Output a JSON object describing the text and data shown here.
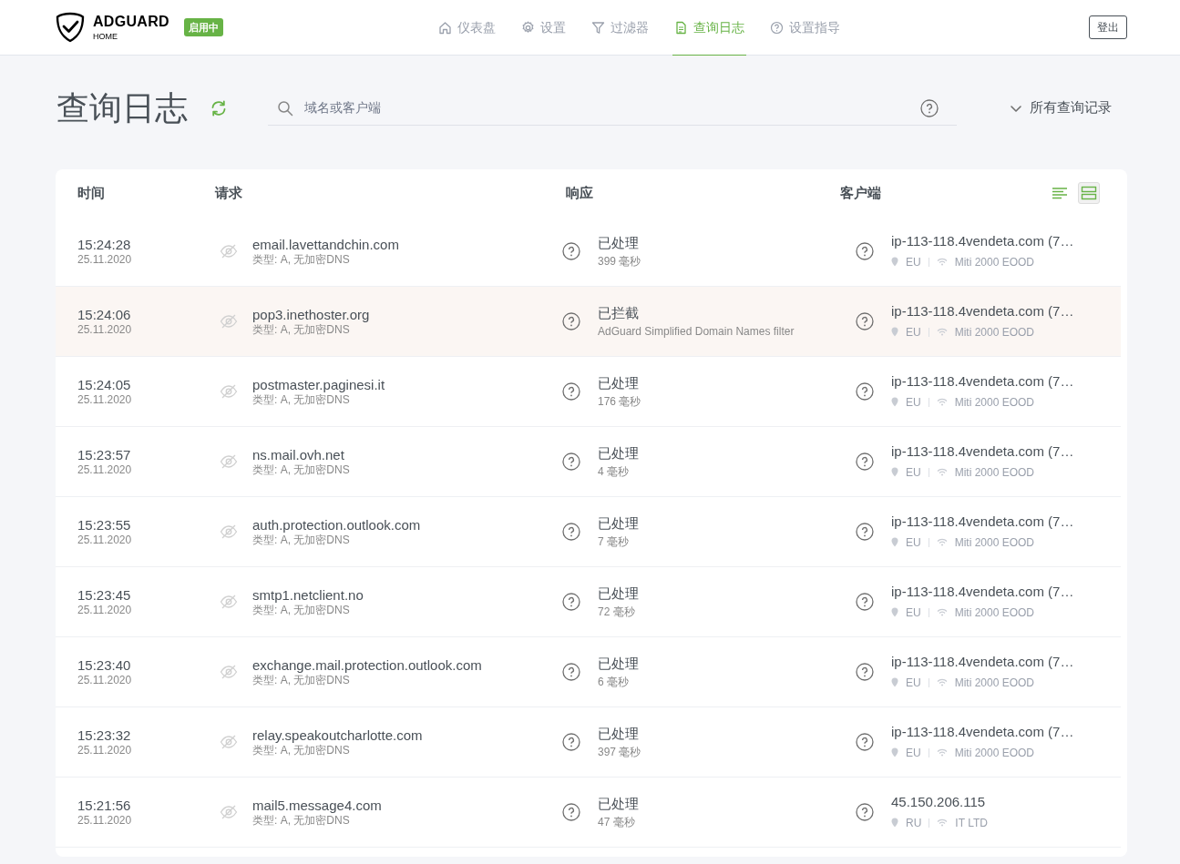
{
  "header": {
    "logo_title": "ADGUARD",
    "logo_subtitle": "HOME",
    "status_badge": "启用中",
    "nav": [
      {
        "label": "仪表盘",
        "selected": false
      },
      {
        "label": "设置",
        "selected": false
      },
      {
        "label": "过滤器",
        "selected": false
      },
      {
        "label": "查询日志",
        "selected": true
      },
      {
        "label": "设置指导",
        "selected": false
      }
    ],
    "logout_button": "登出"
  },
  "page_title": "查询日志",
  "search": {
    "placeholder": "域名或客户端"
  },
  "filter_dropdown": "所有查询记录",
  "table": {
    "columns": [
      "时间",
      "请求",
      "响应",
      "客户端"
    ],
    "view_toggle": [
      {
        "kind": "compact",
        "selected": false
      },
      {
        "kind": "default",
        "selected": true
      }
    ],
    "rows": [
      {
        "time": "15:24:28",
        "date": "25.11.2020",
        "domain": "email.lavettandchin.com",
        "type": "类型: A, 无加密DNS",
        "status": "已处理",
        "detail": "399 毫秒",
        "blocked": false,
        "client": "ip-113-118.4vendeta.com (7…",
        "country": "EU",
        "network": "Miti 2000 EOOD"
      },
      {
        "time": "15:24:06",
        "date": "25.11.2020",
        "domain": "pop3.inethoster.org",
        "type": "类型: A, 无加密DNS",
        "status": "已拦截",
        "detail": "AdGuard Simplified Domain Names filter",
        "blocked": true,
        "client": "ip-113-118.4vendeta.com (7…",
        "country": "EU",
        "network": "Miti 2000 EOOD"
      },
      {
        "time": "15:24:05",
        "date": "25.11.2020",
        "domain": "postmaster.paginesi.it",
        "type": "类型: A, 无加密DNS",
        "status": "已处理",
        "detail": "176 毫秒",
        "blocked": false,
        "client": "ip-113-118.4vendeta.com (7…",
        "country": "EU",
        "network": "Miti 2000 EOOD"
      },
      {
        "time": "15:23:57",
        "date": "25.11.2020",
        "domain": "ns.mail.ovh.net",
        "type": "类型: A, 无加密DNS",
        "status": "已处理",
        "detail": "4 毫秒",
        "blocked": false,
        "client": "ip-113-118.4vendeta.com (7…",
        "country": "EU",
        "network": "Miti 2000 EOOD"
      },
      {
        "time": "15:23:55",
        "date": "25.11.2020",
        "domain": "auth.protection.outlook.com",
        "type": "类型: A, 无加密DNS",
        "status": "已处理",
        "detail": "7 毫秒",
        "blocked": false,
        "client": "ip-113-118.4vendeta.com (7…",
        "country": "EU",
        "network": "Miti 2000 EOOD"
      },
      {
        "time": "15:23:45",
        "date": "25.11.2020",
        "domain": "smtp1.netclient.no",
        "type": "类型: A, 无加密DNS",
        "status": "已处理",
        "detail": "72 毫秒",
        "blocked": false,
        "client": "ip-113-118.4vendeta.com (7…",
        "country": "EU",
        "network": "Miti 2000 EOOD"
      },
      {
        "time": "15:23:40",
        "date": "25.11.2020",
        "domain": "exchange.mail.protection.outlook.com",
        "type": "类型: A, 无加密DNS",
        "status": "已处理",
        "detail": "6 毫秒",
        "blocked": false,
        "client": "ip-113-118.4vendeta.com (7…",
        "country": "EU",
        "network": "Miti 2000 EOOD"
      },
      {
        "time": "15:23:32",
        "date": "25.11.2020",
        "domain": "relay.speakoutcharlotte.com",
        "type": "类型: A, 无加密DNS",
        "status": "已处理",
        "detail": "397 毫秒",
        "blocked": false,
        "client": "ip-113-118.4vendeta.com (7…",
        "country": "EU",
        "network": "Miti 2000 EOOD"
      },
      {
        "time": "15:21:56",
        "date": "25.11.2020",
        "domain": "mail5.message4.com",
        "type": "类型: A, 无加密DNS",
        "status": "已处理",
        "detail": "47 毫秒",
        "blocked": false,
        "client": "45.150.206.115",
        "country": "RU",
        "network": "IT LTD"
      }
    ]
  }
}
